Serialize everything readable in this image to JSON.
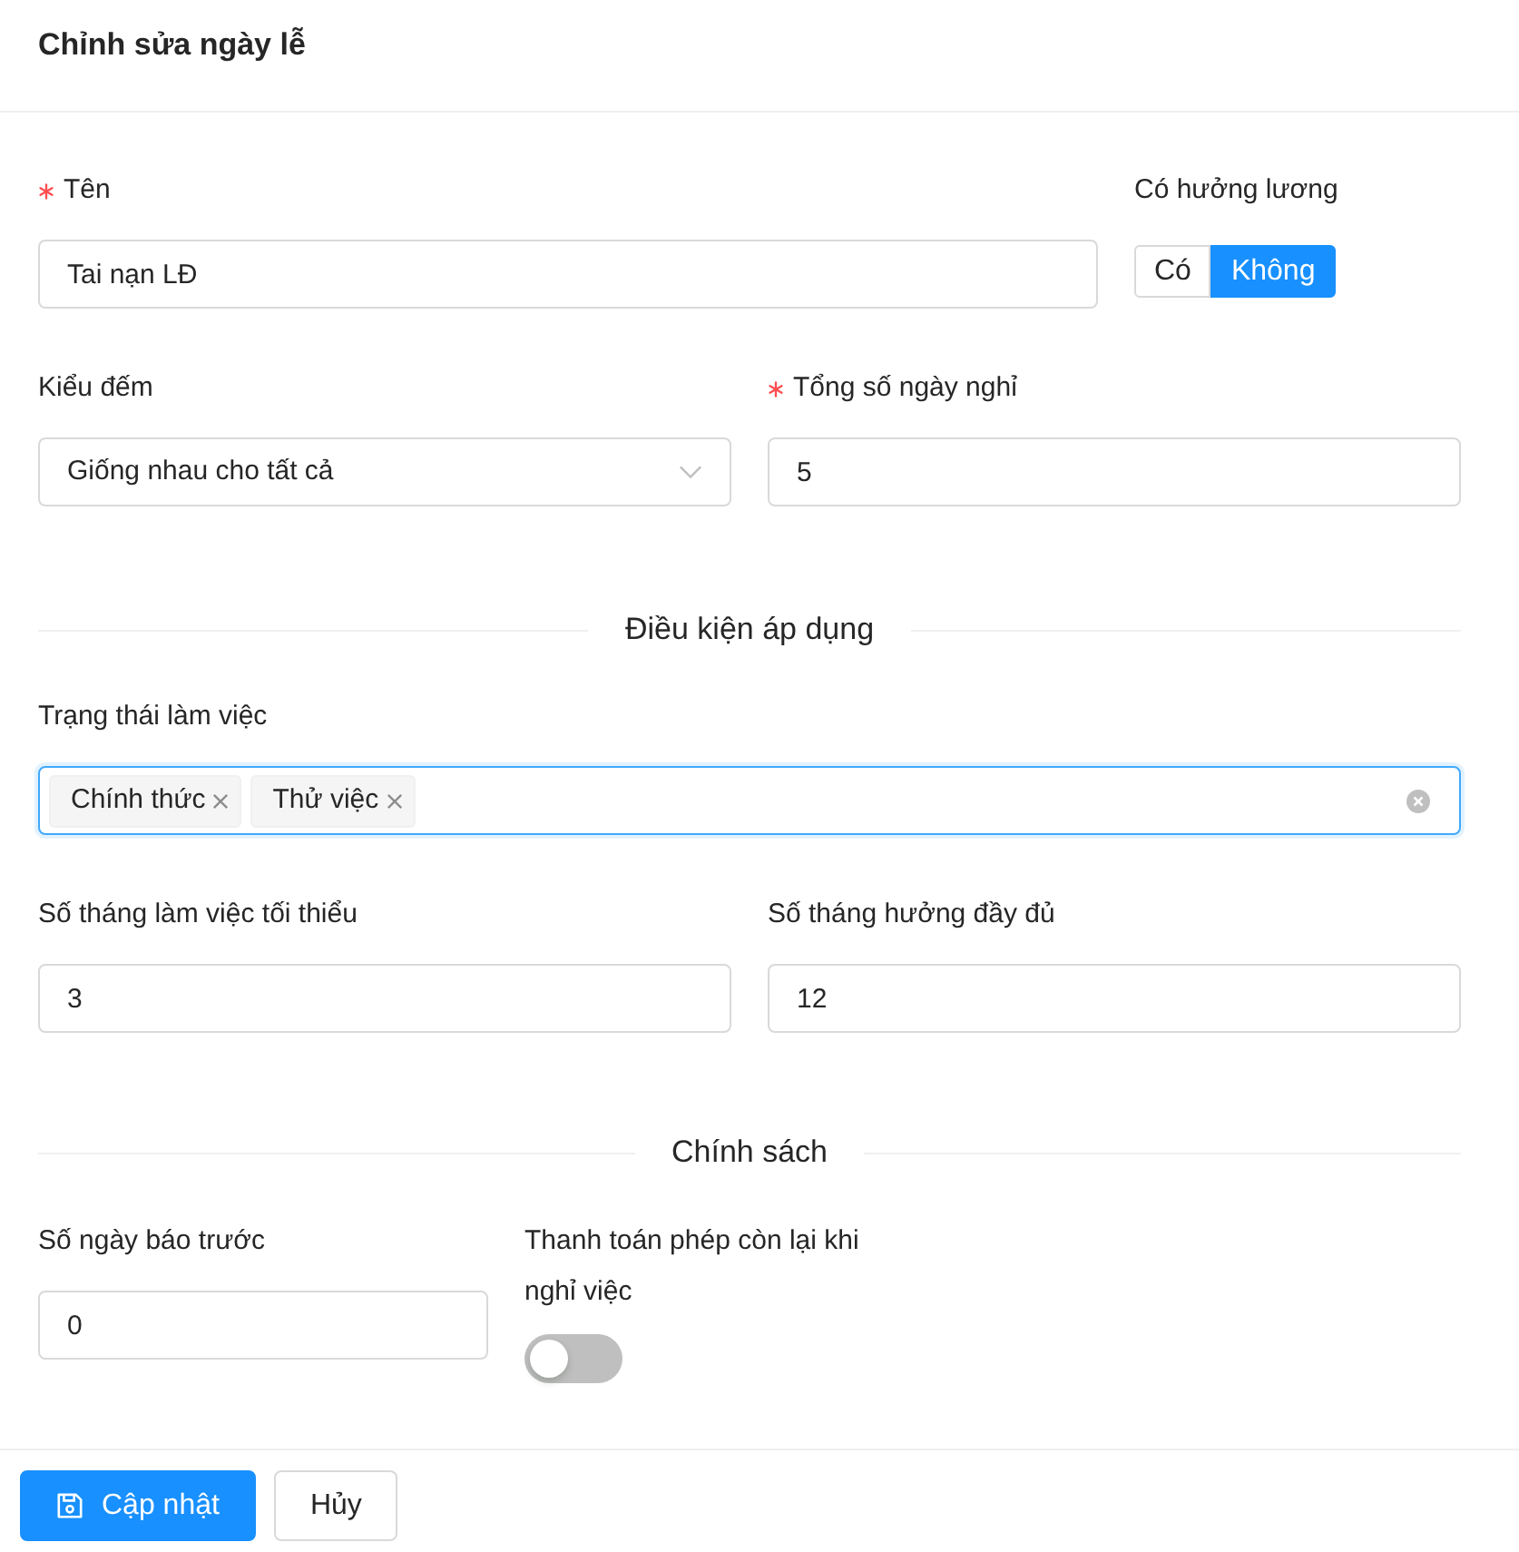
{
  "header": {
    "title": "Chỉnh sửa ngày lễ"
  },
  "general": {
    "name": {
      "label": "Tên",
      "required": true,
      "value": "Tai nạn LĐ"
    },
    "paid": {
      "label": "Có hưởng lương",
      "options": [
        {
          "label": "Có",
          "selected": false
        },
        {
          "label": "Không",
          "selected": true
        }
      ]
    },
    "count_type": {
      "label": "Kiểu đếm",
      "required": false,
      "value": "Giống nhau cho tất cả"
    },
    "total_days": {
      "label": "Tổng số ngày nghỉ",
      "required": true,
      "value": "5"
    }
  },
  "conditions": {
    "title": "Điều kiện áp dụng",
    "work_status": {
      "label": "Trạng thái làm việc",
      "focused": true,
      "tags": [
        "Chính thức",
        "Thử việc"
      ]
    },
    "min_months": {
      "label": "Số tháng làm việc tối thiểu",
      "required": false,
      "value": "3"
    },
    "full_months": {
      "label": "Số tháng hưởng đầy đủ",
      "required": false,
      "value": "12"
    }
  },
  "policy": {
    "title": "Chính sách",
    "notice_days": {
      "label": "Số ngày báo trước",
      "required": false,
      "value": "0"
    },
    "pay_remaining": {
      "label": "Thanh toán phép còn lại khi nghỉ việc",
      "on": false
    }
  },
  "footer": {
    "buttons": [
      {
        "label": "Cập nhật",
        "kind": "primary"
      },
      {
        "label": "Hủy",
        "kind": "default"
      }
    ]
  }
}
